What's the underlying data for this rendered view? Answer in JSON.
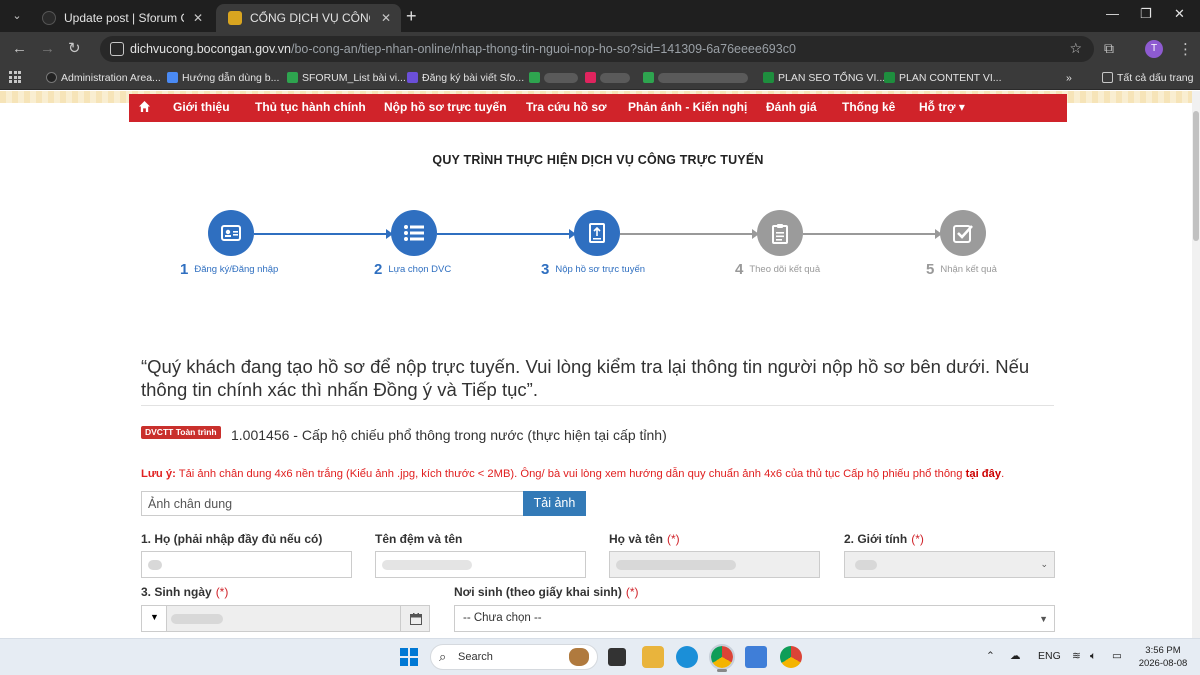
{
  "browser": {
    "tabs": [
      {
        "title": "Update post | Sforum CMS"
      },
      {
        "title": "CỔNG DỊCH VỤ CÔNG TRỰC TU"
      }
    ],
    "url_domain": "dichvucong.bocongan.gov.vn",
    "url_path": "/bo-cong-an/tiep-nhan-online/nhap-thong-tin-nguoi-nop-ho-so?sid=141309-6a76eeee693c0",
    "avatar_letter": "T",
    "bookmarks": [
      "Administration Area...",
      "Hướng dẫn dùng b...",
      "SFORUM_List bài vi...",
      "Đăng ký bài viết Sfo...",
      "PLAN SEO TỔNG VI...",
      "PLAN CONTENT VI..."
    ],
    "all_bookmarks": "Tất cả dấu trang"
  },
  "nav": {
    "items": [
      "Giới thiệu",
      "Thủ tục hành chính",
      "Nộp hồ sơ trực tuyến",
      "Tra cứu hồ sơ",
      "Phản ánh - Kiến nghị",
      "Đánh giá",
      "Thống kê",
      "Hỗ trợ ▾"
    ]
  },
  "process": {
    "title": "QUY TRÌNH THỰC HIỆN DỊCH VỤ CÔNG TRỰC TUYẾN",
    "steps": [
      {
        "num": "1",
        "label": "Đăng ký/Đăng nhập"
      },
      {
        "num": "2",
        "label": "Lựa chọn DVC"
      },
      {
        "num": "3",
        "label": "Nộp hồ sơ trực tuyến"
      },
      {
        "num": "4",
        "label": "Theo dõi kết quả"
      },
      {
        "num": "5",
        "label": "Nhận kết quả"
      }
    ],
    "active_color": "#2f6fc0",
    "inactive_color": "#999999"
  },
  "notice": "“Quý khách đang tạo hồ sơ để nộp trực tuyến. Vui lòng kiểm tra lại thông tin người nộp hồ sơ bên dưới. Nếu thông tin chính xác thì nhấn Đồng ý và Tiếp tục”.",
  "service": {
    "badge": "DVCTT Toàn trình",
    "name": "1.001456 - Cấp hộ chiếu phổ thông trong nước (thực hiện tại cấp tỉnh)"
  },
  "note": {
    "prefix": "Lưu ý:",
    "text": " Tải ảnh chân dung 4x6 nền trắng (Kiểu ảnh .jpg, kích thước < 2MB). Ông/ bà vui lòng xem hướng dẫn quy chuẩn ảnh 4x6 của thủ tục Cấp hộ phiếu phổ thông ",
    "link": "tại đây",
    "suffix": "."
  },
  "photo": {
    "placeholder": "Ảnh chân dung",
    "button": "Tải ảnh"
  },
  "form": {
    "ho_label": "1. Họ (phải nhập đầy đủ nếu có)",
    "ten_label": "Tên đệm và tên",
    "hoten_label": "Họ và tên",
    "gioitinh_label": "2. Giới tính",
    "sinhngay_label": "3. Sinh ngày",
    "noisinh_label": "Nơi sinh (theo giấy khai sinh)",
    "noisinh_value": "-- Chưa chọn --",
    "required_mark": "(*)"
  },
  "taskbar": {
    "search": "Search",
    "lang": "ENG",
    "time": "3:56 PM",
    "date": "2026-08-08"
  }
}
